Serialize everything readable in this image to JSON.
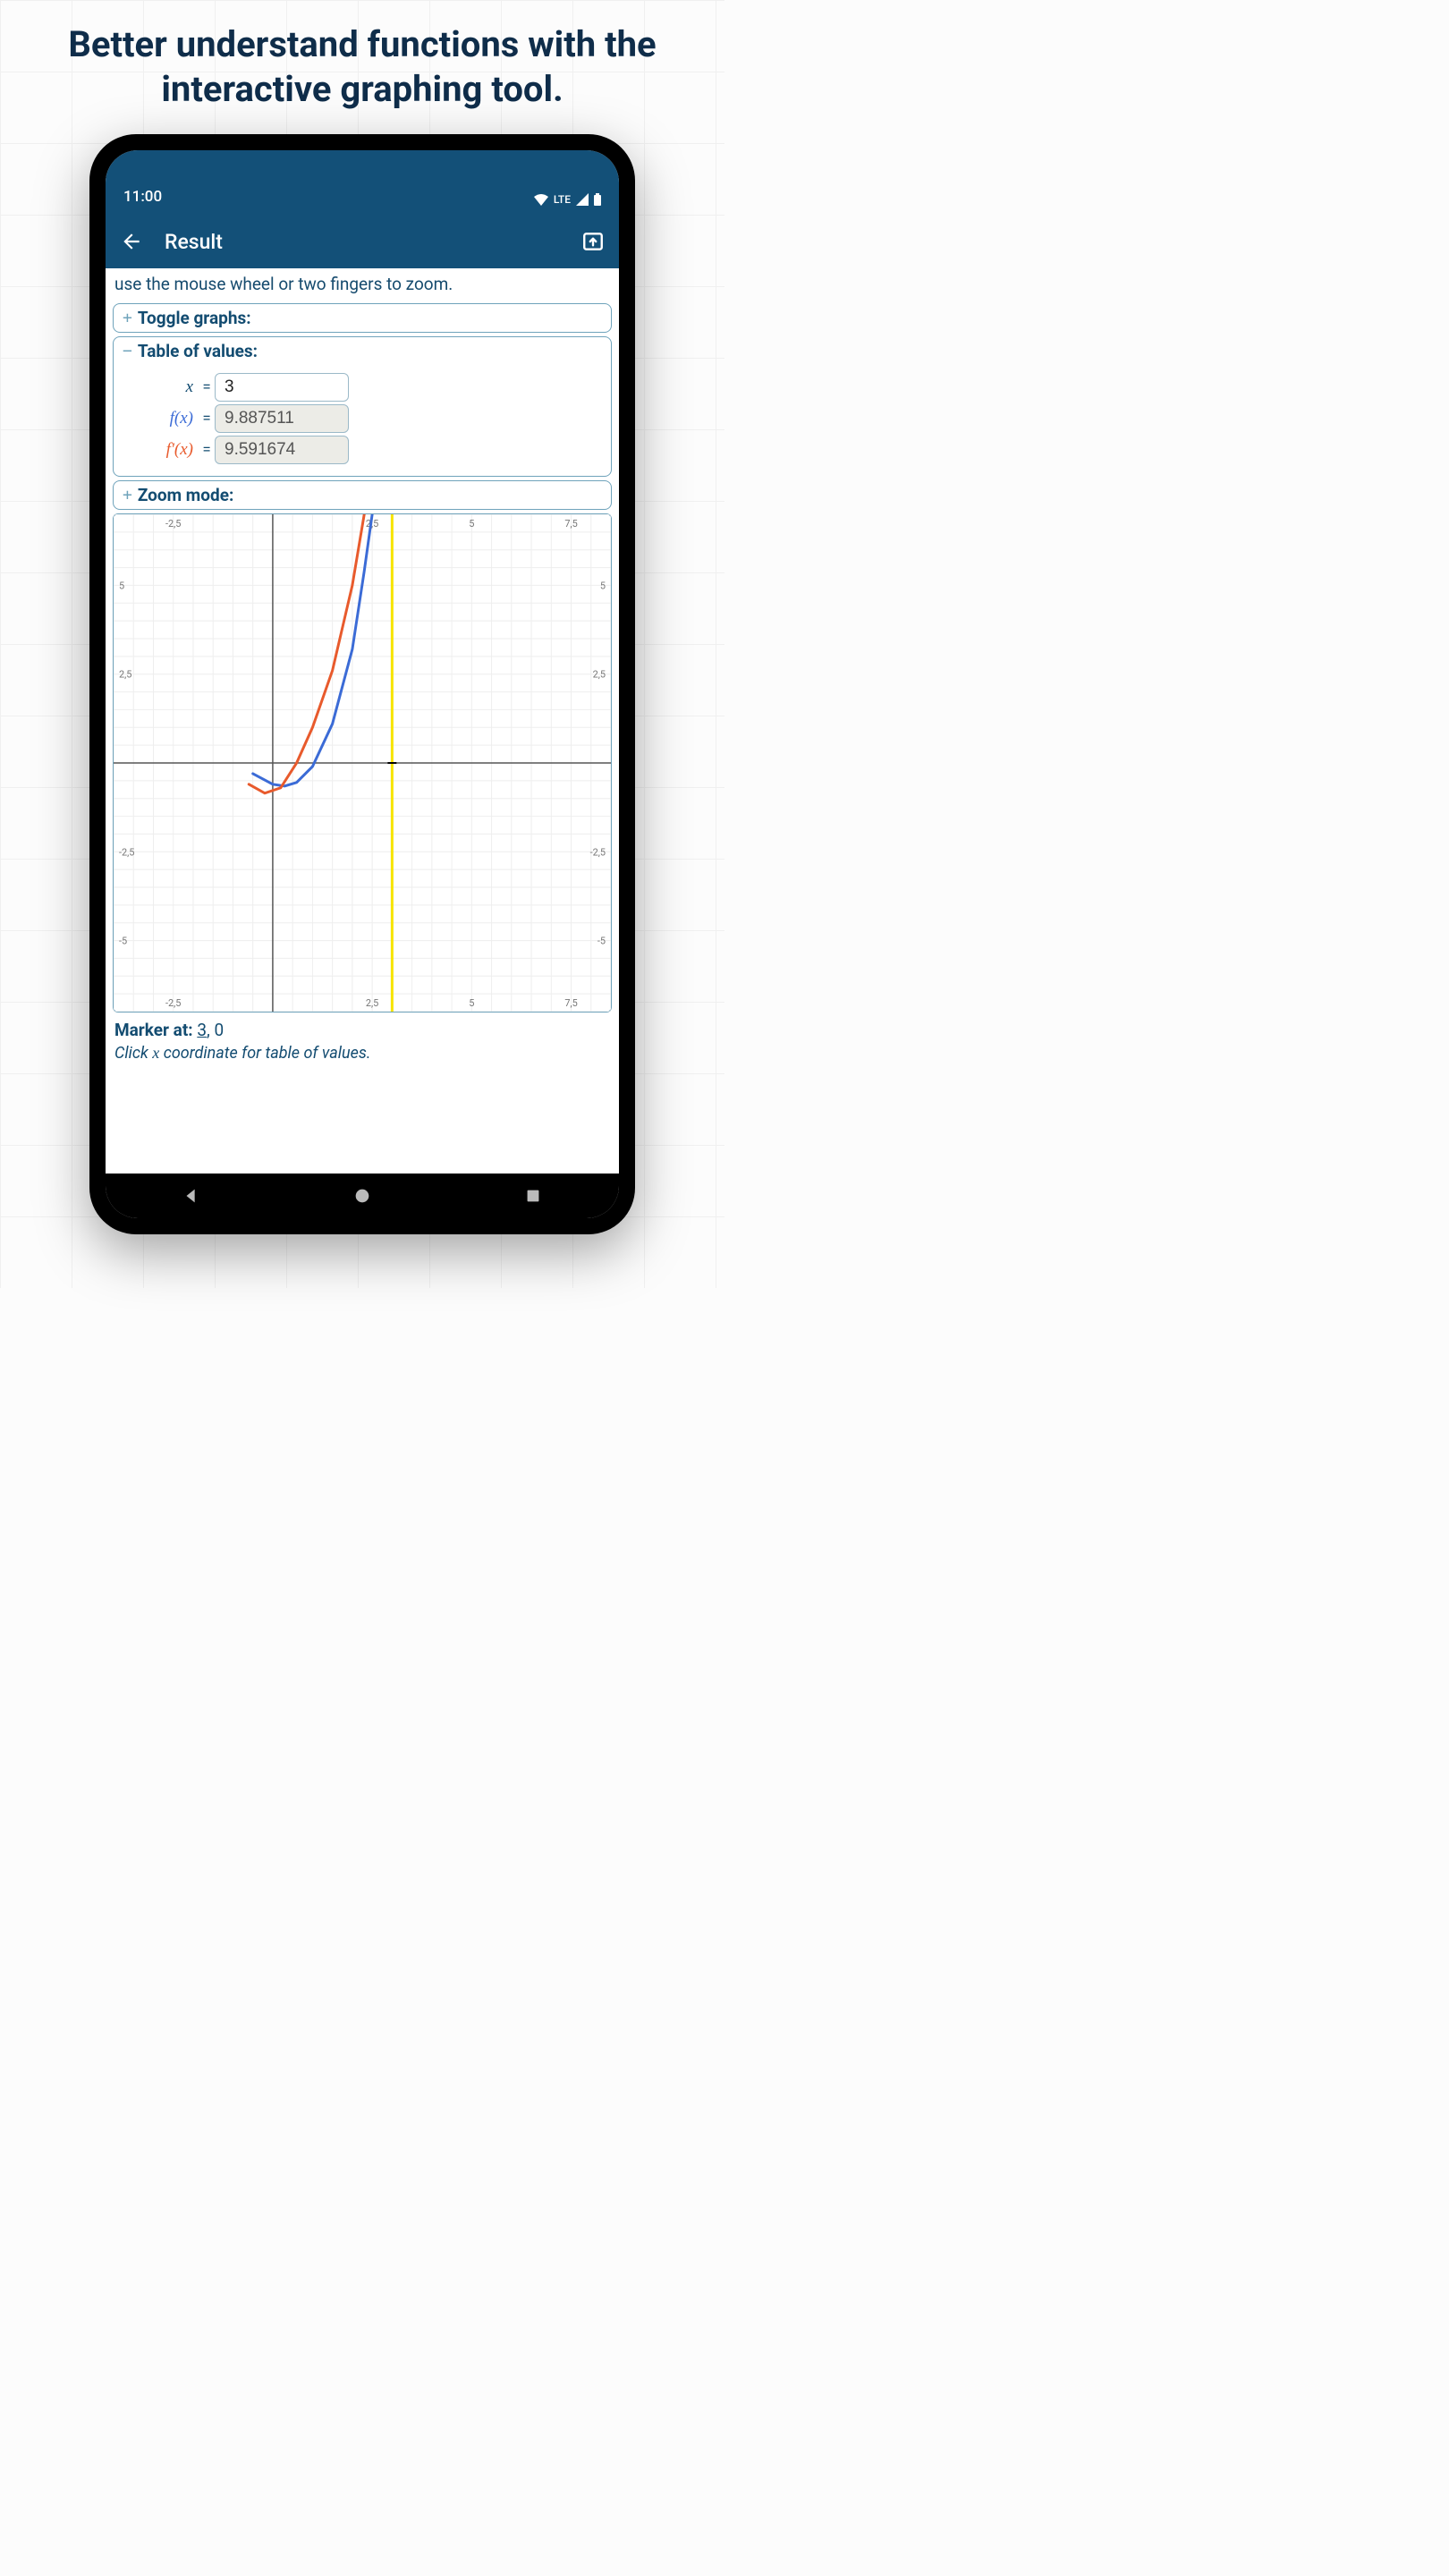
{
  "headline": "Better understand functions with the interactive graphing tool.",
  "status": {
    "time": "11:00",
    "network": "LTE"
  },
  "appbar": {
    "title": "Result"
  },
  "hint": "use the mouse wheel or two fingers to zoom.",
  "panels": {
    "toggle": {
      "sign": "+",
      "label": "Toggle graphs:"
    },
    "table": {
      "sign": "−",
      "label": "Table of values:",
      "x_label": "x",
      "x_value": "3",
      "f_label": "f(x)",
      "f_value": "9.887511",
      "fp_label": "f'(x)",
      "fp_value": "9.591674"
    },
    "zoom": {
      "sign": "+",
      "label": "Zoom mode:"
    }
  },
  "marker": {
    "label": "Marker at:",
    "x": "3",
    "y": "0",
    "hint_prefix": "Click ",
    "hint_x": "x",
    "hint_suffix": " coordinate for table of values."
  },
  "chart_data": {
    "type": "line",
    "xlabel": "",
    "ylabel": "",
    "xlim": [
      -4,
      8.5
    ],
    "ylim": [
      -7,
      7
    ],
    "xticks": [
      -2.5,
      2.5,
      5,
      7.5
    ],
    "yticks": [
      -5,
      -2.5,
      2.5,
      5
    ],
    "marker_x": 3,
    "series": [
      {
        "name": "f(x)",
        "color": "#3b6bd6",
        "points": [
          {
            "x": -0.5,
            "y": -0.3
          },
          {
            "x": 0.0,
            "y": -0.6
          },
          {
            "x": 0.3,
            "y": -0.65
          },
          {
            "x": 0.6,
            "y": -0.55
          },
          {
            "x": 1.0,
            "y": -0.1
          },
          {
            "x": 1.5,
            "y": 1.1
          },
          {
            "x": 2.0,
            "y": 3.2
          },
          {
            "x": 2.3,
            "y": 5.4
          },
          {
            "x": 2.5,
            "y": 7.0
          }
        ]
      },
      {
        "name": "f'(x)",
        "color": "#e85a2c",
        "points": [
          {
            "x": -0.6,
            "y": -0.6
          },
          {
            "x": -0.2,
            "y": -0.85
          },
          {
            "x": 0.2,
            "y": -0.7
          },
          {
            "x": 0.6,
            "y": -0.0
          },
          {
            "x": 1.0,
            "y": 1.0
          },
          {
            "x": 1.5,
            "y": 2.6
          },
          {
            "x": 2.0,
            "y": 5.0
          },
          {
            "x": 2.3,
            "y": 7.0
          }
        ]
      }
    ]
  }
}
